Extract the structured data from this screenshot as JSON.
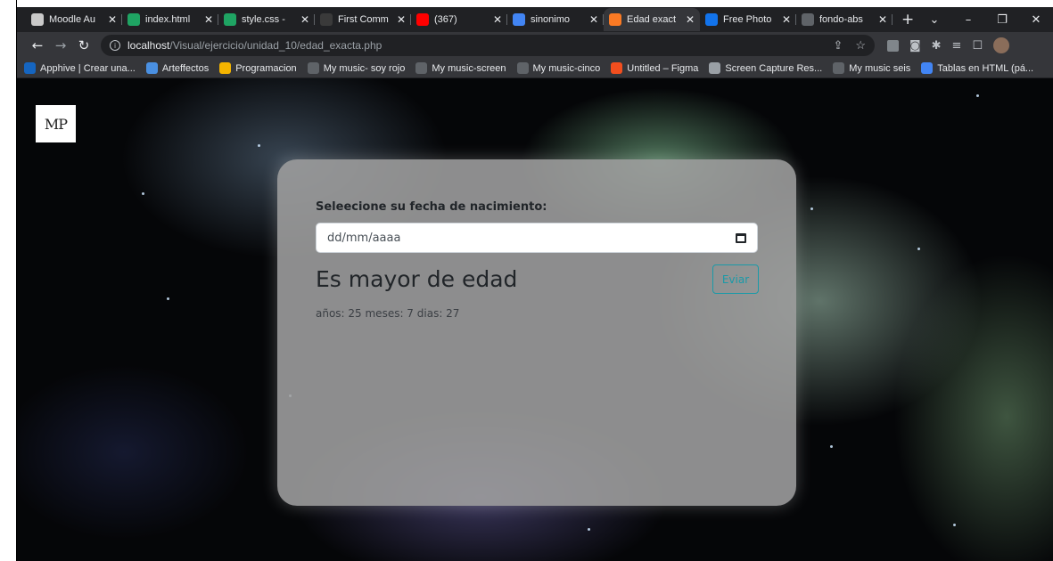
{
  "tabs": [
    {
      "title": "Moodle Au",
      "icon": "moodle-icon",
      "color": "#c9c9c9"
    },
    {
      "title": "index.html",
      "icon": "drive-icon",
      "color": "#1fa463"
    },
    {
      "title": "style.css -",
      "icon": "drive-icon",
      "color": "#1fa463"
    },
    {
      "title": "First Comm",
      "icon": "github-icon",
      "color": "#3a3a3a"
    },
    {
      "title": "(367)",
      "icon": "youtube-icon",
      "color": "#ff0000"
    },
    {
      "title": "sinonimo",
      "icon": "google-icon",
      "color": "#4285f4"
    },
    {
      "title": "Edad exact",
      "icon": "xampp-icon",
      "color": "#fb7a24"
    },
    {
      "title": "Free Photo",
      "icon": "freepik-icon",
      "color": "#1273eb"
    },
    {
      "title": "fondo-abs",
      "icon": "globe-icon",
      "color": "#5f6368"
    }
  ],
  "active_tab_index": 6,
  "new_tab_symbol": "+",
  "url": {
    "host": "localhost",
    "path": "/Visual/ejercicio/unidad_10/edad_exacta.php"
  },
  "bookmarks": [
    {
      "label": "Apphive | Crear una...",
      "color": "#1565c0"
    },
    {
      "label": "Arteffectos",
      "color": "#4a90e2"
    },
    {
      "label": "Programacion",
      "color": "#f4b400"
    },
    {
      "label": "My music- soy rojo",
      "color": "#5f6368"
    },
    {
      "label": "My music-screen",
      "color": "#5f6368"
    },
    {
      "label": "My music-cinco",
      "color": "#5f6368"
    },
    {
      "label": "Untitled – Figma",
      "color": "#f24e1e"
    },
    {
      "label": "Screen Capture Res...",
      "color": "#9aa0a6"
    },
    {
      "label": "My music seis",
      "color": "#5f6368"
    },
    {
      "label": "Tablas en HTML (pá...",
      "color": "#4285f4"
    }
  ],
  "logo_text": "MP",
  "form": {
    "label": "Seleecione su fecha de nacimiento:",
    "placeholder": "dd/mm/aaaa",
    "result_heading": "Es mayor de edad",
    "submit_label": "Eviar",
    "age_details": "años: 25 meses: 7 dias: 27"
  },
  "colors": {
    "accent": "#1a9aa8",
    "card_bg": "#a0a0a0",
    "chrome_dark": "#202124"
  }
}
